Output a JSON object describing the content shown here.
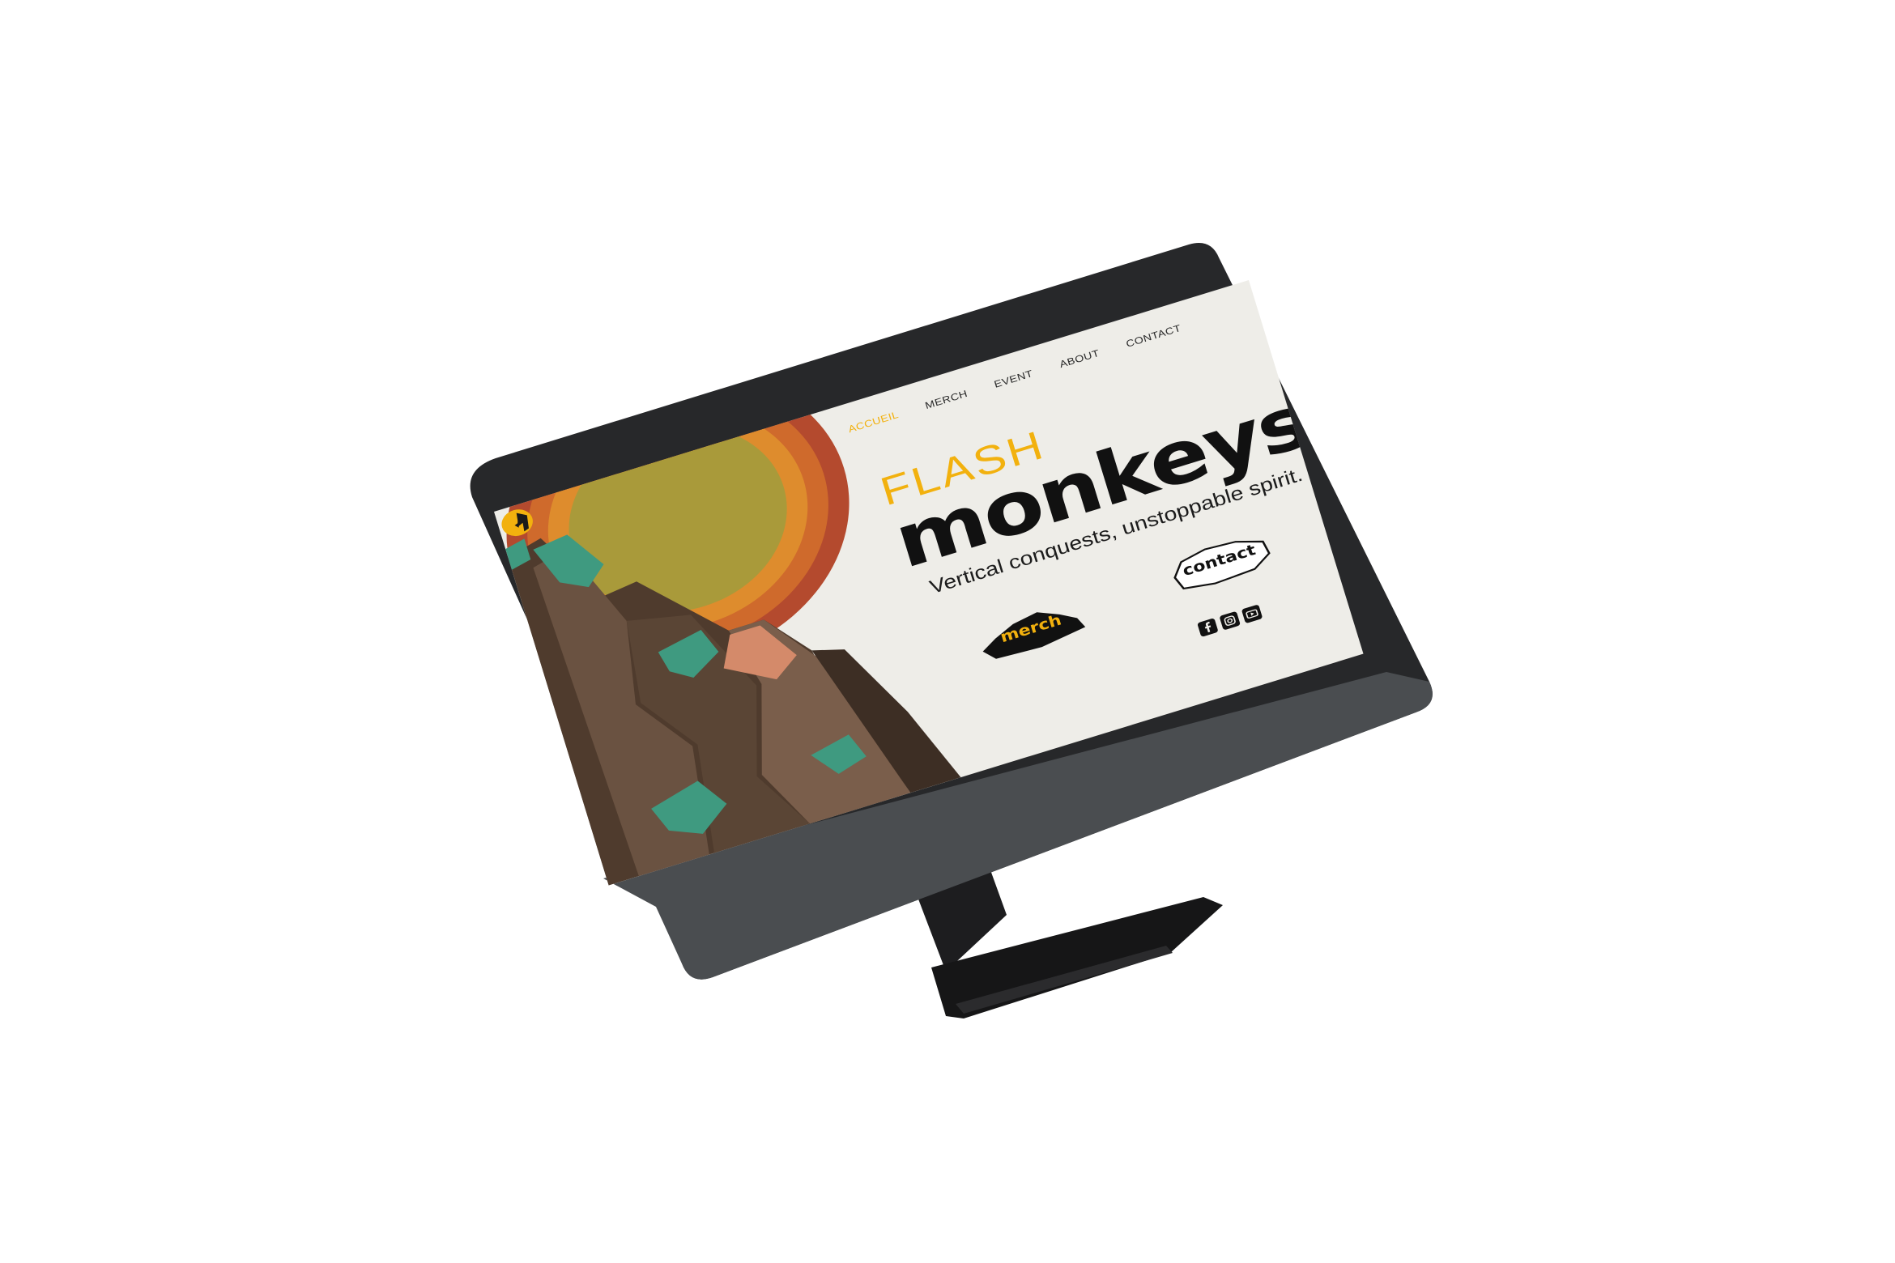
{
  "nav": {
    "items": [
      {
        "label": "ACCUEIL",
        "active": true
      },
      {
        "label": "MERCH",
        "active": false
      },
      {
        "label": "EVENT",
        "active": false
      },
      {
        "label": "ABOUT",
        "active": false
      },
      {
        "label": "CONTACT",
        "active": false
      }
    ]
  },
  "hero": {
    "title_top": "FLASH",
    "title_main": "monkeys",
    "tagline": "Vertical conquests, unstoppable spirit."
  },
  "buttons": {
    "merch": "merch",
    "contact": "contact"
  },
  "socials": [
    "facebook-icon",
    "instagram-icon",
    "youtube-icon"
  ],
  "colors": {
    "accent": "#f2b10e",
    "page_bg": "#eeede8",
    "text": "#111111",
    "rock": "#5c4636",
    "moss": "#3f9a80"
  }
}
